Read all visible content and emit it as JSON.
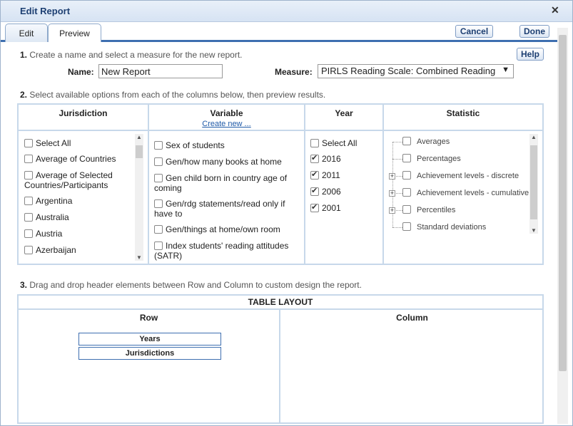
{
  "window": {
    "title": "Edit Report",
    "close_glyph": "✕"
  },
  "tabs": [
    {
      "label": "Edit"
    },
    {
      "label": "Preview"
    }
  ],
  "buttons": {
    "cancel": "Cancel",
    "done": "Done",
    "help": "Help"
  },
  "step1": {
    "num": "1.",
    "text": "Create a name and select a measure for the new report."
  },
  "name": {
    "label": "Name:",
    "value": "New Report"
  },
  "measure": {
    "label": "Measure:",
    "value": "PIRLS Reading Scale: Combined Reading",
    "caret": "▼"
  },
  "step2": {
    "num": "2.",
    "text": "Select available options from each of the columns below, then preview results."
  },
  "columns": {
    "jurisdiction": {
      "header": "Jurisdiction",
      "items": [
        "Select All",
        "Average of Countries",
        "Average of Selected Countries/Participants",
        "Argentina",
        "Australia",
        "Austria",
        "Azerbaijan"
      ]
    },
    "variable": {
      "header": "Variable",
      "link": "Create new ...",
      "items": [
        "Sex of students",
        "Gen/how many books at home",
        "Gen child born in country age of coming",
        "Gen/rdg statements/read only if have to",
        "Gen/things at home/own room",
        "Index students' reading attitudes (SATR)"
      ]
    },
    "year": {
      "header": "Year",
      "items": [
        {
          "label": "Select All",
          "checked": false
        },
        {
          "label": "2016",
          "checked": true
        },
        {
          "label": "2011",
          "checked": true
        },
        {
          "label": "2006",
          "checked": true
        },
        {
          "label": "2001",
          "checked": true
        }
      ]
    },
    "statistic": {
      "header": "Statistic",
      "items": [
        "Averages",
        "Percentages",
        "Achievement levels - discrete",
        "Achievement levels - cumulative",
        "Percentiles",
        "Standard deviations"
      ]
    }
  },
  "step3": {
    "num": "3.",
    "text": "Drag and drop header elements between Row and Column to custom design the report."
  },
  "table_layout": {
    "title": "TABLE LAYOUT",
    "row_header": "Row",
    "column_header": "Column",
    "row_items": [
      "Years",
      "Jurisdictions"
    ]
  },
  "glyphs": {
    "up": "▲",
    "down": "▼",
    "plus": "+"
  }
}
